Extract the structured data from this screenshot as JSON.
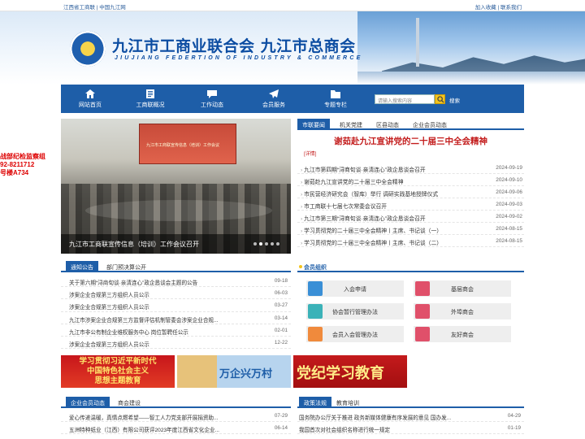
{
  "topbar": {
    "left": "江西省工商联 | 中国九江网",
    "right": "加入收藏 | 联系我们"
  },
  "banner": {
    "title_cn": "九江市工商业联合会 九江市总商会",
    "title_en": "JIUJIANG FEDERTION OF INDUSTRY & COMMERCE"
  },
  "nav": {
    "items": [
      {
        "label": "网站首页",
        "icon": "home-icon"
      },
      {
        "label": "工商联概况",
        "icon": "document-icon"
      },
      {
        "label": "工作动态",
        "icon": "chat-icon"
      },
      {
        "label": "会员服务",
        "icon": "send-icon"
      },
      {
        "label": "专题专栏",
        "icon": "folder-icon"
      }
    ],
    "search_placeholder": "请输入搜索内容",
    "advanced_label": "搜索"
  },
  "slide": {
    "caption": "九江市工商联宣传信息（培训）工作会议召开",
    "screen_text": "九江市工商联宣传信息（培训）工作会议"
  },
  "float_ad": {
    "line1": "战部纪检监察组",
    "line2": "92-8211712",
    "line3": "号楼A734"
  },
  "news": {
    "tabs": [
      "市联要闻",
      "机关党建",
      "区县动态",
      "企业会员动态"
    ],
    "headline": "谢茹赴九江宣讲党的二十届三中全会精神",
    "more": "[详情]",
    "items": [
      {
        "title": "九江市第四期“浔商旬谈·亲清连心”政企恳谈会召开",
        "date": "2024-09-19"
      },
      {
        "title": "谢茹赴九江宣讲党的二十届三中全会精神",
        "date": "2024-09-10"
      },
      {
        "title": "市民营经济研究会（智库）举行 调研实践基地授牌仪式",
        "date": "2024-09-06"
      },
      {
        "title": "市工商联十七届七次常委会议召开",
        "date": "2024-09-03"
      },
      {
        "title": "九江市第三期“浔商旬谈·亲清连心”政企恳谈会召开",
        "date": "2024-09-02"
      },
      {
        "title": "学习贯彻党的二十届三中全会精神丨主席、书记谈（一）",
        "date": "2024-08-15"
      },
      {
        "title": "学习贯彻党的二十届三中全会精神丨主席、书记谈（二）",
        "date": "2024-08-15"
      }
    ]
  },
  "notice": {
    "tabs": [
      "通知公告",
      "部门预决算公开"
    ],
    "items": [
      {
        "title": "关于第六期“浔商旬谈·亲清连心”政企恳谈会主题的公告",
        "date": "09-18"
      },
      {
        "title": "涉案企业合规第三方组织人员公示",
        "date": "06-03"
      },
      {
        "title": "涉案企业合规第三方组织人员公示",
        "date": "03-27"
      },
      {
        "title": "九江市涉案企业合规第三方监督评估机制管委会涉案企业合规...",
        "date": "03-14"
      },
      {
        "title": "九江市非公有制企业维权服务中心 岗位暂聘任公示",
        "date": "02-01"
      },
      {
        "title": "涉案企业合规第三方组织人员公示",
        "date": "12-22"
      }
    ]
  },
  "member": {
    "title": "会员组织",
    "buttons": [
      {
        "label": "入会申请",
        "icon": "apply-icon",
        "color": "#3a8fd6"
      },
      {
        "label": "基层商会",
        "icon": "building-icon",
        "color": "#e0506a"
      },
      {
        "label": "协会暂行管理办法",
        "icon": "rules-icon",
        "color": "#3bb2b8"
      },
      {
        "label": "外埠商会",
        "icon": "chart-icon",
        "color": "#e0506a"
      },
      {
        "label": "会员入会管理办法",
        "icon": "gear-icon",
        "color": "#f08a3c"
      },
      {
        "label": "友好商会",
        "icon": "handshake-icon",
        "color": "#e0506a"
      }
    ]
  },
  "ads": {
    "ad1_line1": "学习贯彻习近平新时代",
    "ad1_line2": "中国特色社会主义",
    "ad1_line3": "思想主题教育",
    "ad2": "万企兴万村",
    "ad3": "党纪学习教育"
  },
  "bottom_left": {
    "tabs": [
      "企业会员动态",
      "商会建设"
    ],
    "items": [
      {
        "title": "爱心传递温暖，真情点燃希望——智工人力党支部开展捐资助...",
        "date": "07-29"
      },
      {
        "title": "五洲特种纸业（江西）有限公司获评2023年度江西省文化企业...",
        "date": "06-14"
      }
    ]
  },
  "bottom_right": {
    "tabs": [
      "政策法规",
      "教育培训"
    ],
    "items": [
      {
        "title": "国务院办公厅关于推进 政务新媒体健康有序发展的意见 国办发...",
        "date": "04-29"
      },
      {
        "title": "我国首次对社会组织名称进行统一规定",
        "date": "01-19"
      }
    ]
  },
  "colors": {
    "primary": "#1e5ea8",
    "headline": "#c31c1c",
    "accent": "#f3c41d"
  }
}
